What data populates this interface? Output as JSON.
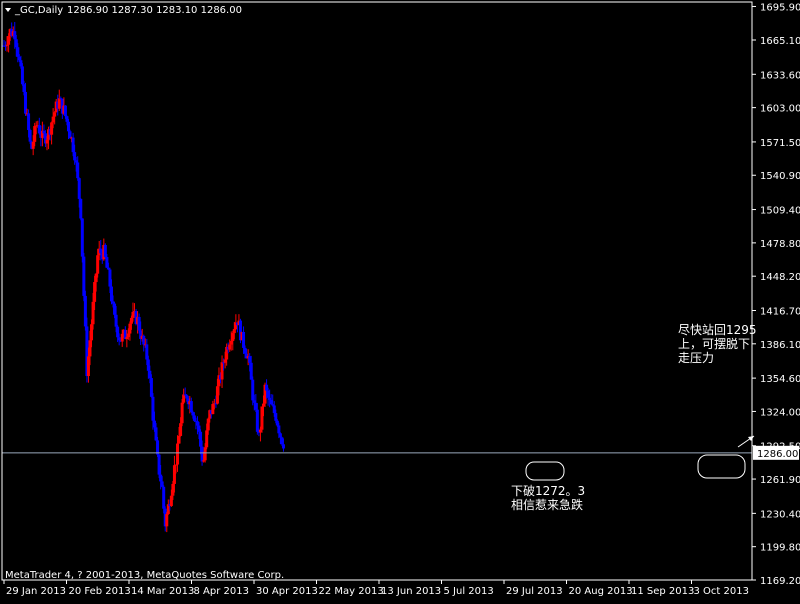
{
  "header": {
    "symbol": "_GC,Daily",
    "ohlc": "1286.90 1287.30 1283.10 1286.00"
  },
  "footer": {
    "copyright": "MetaTrader 4, ? 2001-2013, MetaQuotes Software Corp."
  },
  "colors": {
    "background": "#000000",
    "frame": "#ffffff",
    "bull": "#ff0000",
    "bear": "#0000ff",
    "text": "#ffffff",
    "price_line": "#9aa9bd"
  },
  "chart_data": {
    "type": "candlestick",
    "ylim": [
      1169.2,
      1700
    ],
    "y_ticks": [
      "1695.90",
      "1665.10",
      "1633.60",
      "1603.00",
      "1571.50",
      "1540.90",
      "1509.40",
      "1478.80",
      "1448.20",
      "1416.70",
      "1386.10",
      "1354.60",
      "1324.00",
      "1292.50",
      "1261.90",
      "1230.40",
      "1199.80",
      "1169.20"
    ],
    "x_ticks": [
      "29 Jan 2013",
      "20 Feb 2013",
      "14 Mar 2013",
      "8 Apr 2013",
      "30 Apr 2013",
      "22 May 2013",
      "13 Jun 2013",
      "5 Jul 2013",
      "29 Jul 2013",
      "20 Aug 2013",
      "11 Sep 2013",
      "3 Oct 2013"
    ],
    "current_price": 1286.0,
    "current_price_label": "1286.00",
    "bar_count": 183,
    "anchors": [
      [
        0,
        1660
      ],
      [
        6,
        1673
      ],
      [
        11,
        1672
      ],
      [
        16,
        1640
      ],
      [
        22,
        1600
      ],
      [
        27,
        1563
      ],
      [
        33,
        1590
      ],
      [
        38,
        1575
      ],
      [
        44,
        1578
      ],
      [
        49,
        1595
      ],
      [
        55,
        1610
      ],
      [
        60,
        1600
      ],
      [
        66,
        1580
      ],
      [
        71,
        1560
      ],
      [
        77,
        1505
      ],
      [
        79,
        1450
      ],
      [
        83,
        1360
      ],
      [
        89,
        1420
      ],
      [
        94,
        1470
      ],
      [
        100,
        1470
      ],
      [
        106,
        1440
      ],
      [
        110,
        1410
      ],
      [
        116,
        1390
      ],
      [
        122,
        1395
      ],
      [
        127,
        1410
      ],
      [
        133,
        1410
      ],
      [
        138,
        1390
      ],
      [
        144,
        1370
      ],
      [
        150,
        1310
      ],
      [
        154,
        1275
      ],
      [
        158,
        1255
      ],
      [
        161,
        1220
      ],
      [
        166,
        1245
      ],
      [
        170,
        1270
      ],
      [
        174,
        1290
      ],
      [
        178,
        1330
      ],
      [
        183,
        1340
      ],
      [
        189,
        1325
      ],
      [
        194,
        1310
      ],
      [
        199,
        1275
      ],
      [
        205,
        1320
      ],
      [
        210,
        1330
      ],
      [
        216,
        1355
      ],
      [
        222,
        1380
      ],
      [
        227,
        1395
      ],
      [
        233,
        1410
      ],
      [
        238,
        1390
      ],
      [
        244,
        1375
      ],
      [
        250,
        1330
      ],
      [
        255,
        1300
      ],
      [
        261,
        1345
      ],
      [
        266,
        1330
      ],
      [
        272,
        1320
      ],
      [
        277,
        1300
      ],
      [
        281,
        1293
      ]
    ],
    "annotations": [
      {
        "lines": [
          "下破1272。3",
          "相信惹来急跌"
        ]
      },
      {
        "lines": [
          "尽快站回1295",
          "上，可摆脱下",
          "走压力"
        ]
      }
    ]
  }
}
